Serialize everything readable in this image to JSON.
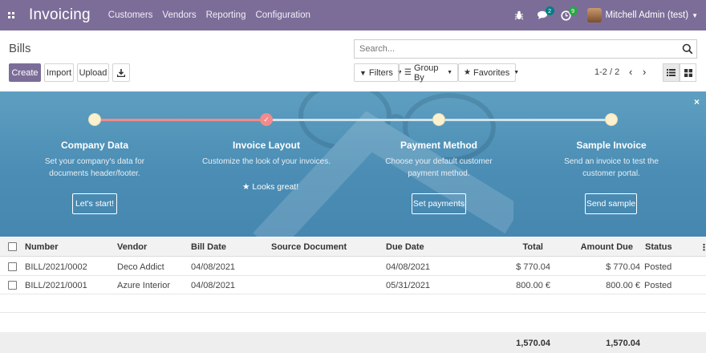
{
  "navbar": {
    "app_title": "Invoicing",
    "menu": [
      "Customers",
      "Vendors",
      "Reporting",
      "Configuration"
    ],
    "messages_count": "2",
    "activities_count": "9",
    "user_name": "Mitchell Admin (test)"
  },
  "control_panel": {
    "breadcrumb": "Bills",
    "create_label": "Create",
    "import_label": "Import",
    "upload_label": "Upload",
    "search_placeholder": "Search...",
    "filters_label": "Filters",
    "group_by_label": "Group By",
    "favorites_label": "Favorites",
    "pager": "1-2 / 2"
  },
  "onboarding": {
    "steps": [
      {
        "title": "Company Data",
        "desc_line1": "Set your company's data for",
        "desc_line2": "documents header/footer.",
        "button": "Let's start!"
      },
      {
        "title": "Invoice Layout",
        "desc_line1": "Customize the look of your invoices.",
        "done_text": "Looks great!"
      },
      {
        "title": "Payment Method",
        "desc_line1": "Choose your default customer",
        "desc_line2": "payment method.",
        "button": "Set payments"
      },
      {
        "title": "Sample Invoice",
        "desc_line1": "Send an invoice to test the",
        "desc_line2": "customer portal.",
        "button": "Send sample"
      }
    ]
  },
  "table": {
    "columns": [
      "Number",
      "Vendor",
      "Bill Date",
      "Source Document",
      "Due Date",
      "Total",
      "Amount Due",
      "Status"
    ],
    "rows": [
      {
        "number": "BILL/2021/0002",
        "vendor": "Deco Addict",
        "bill_date": "04/08/2021",
        "source": "",
        "due_date": "04/08/2021",
        "total": "$ 770.04",
        "amount_due": "$ 770.04",
        "status": "Posted"
      },
      {
        "number": "BILL/2021/0001",
        "vendor": "Azure Interior",
        "bill_date": "04/08/2021",
        "source": "",
        "due_date": "05/31/2021",
        "total": "800.00 €",
        "amount_due": "800.00 €",
        "status": "Posted"
      }
    ],
    "totals": {
      "total": "1,570.04",
      "amount_due": "1,570.04"
    }
  },
  "colors": {
    "brand": "#7c6d98",
    "banner": "#4b8db4",
    "progress_done": "#f28b8b"
  }
}
